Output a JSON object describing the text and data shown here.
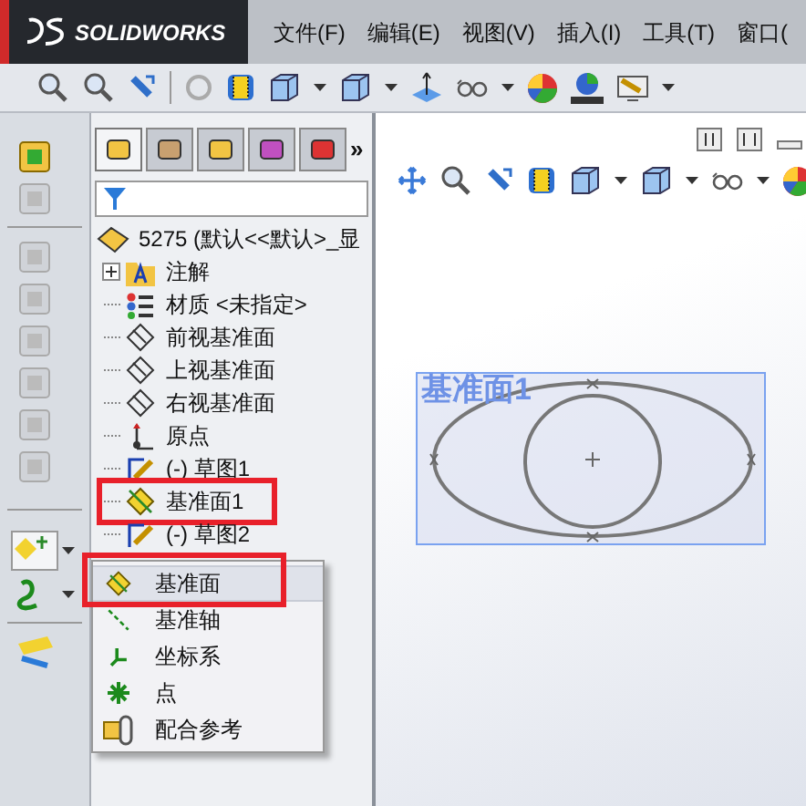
{
  "title_bar": {
    "logo": "SOLIDWORKS",
    "menu": [
      "文件(F)",
      "编辑(E)",
      "视图(V)",
      "插入(I)",
      "工具(T)",
      "窗口("
    ]
  },
  "feature_manager": {
    "tabs": [
      {
        "selected": true
      },
      {
        "selected": false
      },
      {
        "selected": false
      },
      {
        "selected": false
      },
      {
        "selected": false
      }
    ],
    "more": "»",
    "tree": {
      "label": "5275  (默认<<默认>_显",
      "children": [
        {
          "kind": "annotations",
          "label": "注解",
          "expander": true,
          "highlighted": false
        },
        {
          "kind": "material",
          "label": "材质 <未指定>",
          "expander": false,
          "highlighted": false
        },
        {
          "kind": "plane",
          "label": "前视基准面",
          "expander": false,
          "highlighted": false
        },
        {
          "kind": "plane",
          "label": "上视基准面",
          "expander": false,
          "highlighted": false
        },
        {
          "kind": "plane",
          "label": "右视基准面",
          "expander": false,
          "highlighted": false
        },
        {
          "kind": "origin",
          "label": "原点",
          "expander": false,
          "highlighted": false
        },
        {
          "kind": "sketch",
          "label": "(-) 草图1",
          "expander": false,
          "highlighted": false
        },
        {
          "kind": "refplane",
          "label": "基准面1",
          "expander": false,
          "highlighted": true
        },
        {
          "kind": "sketch",
          "label": "(-) 草图2",
          "expander": false,
          "highlighted": false
        }
      ]
    }
  },
  "graphics": {
    "plane_label": "基准面1"
  },
  "flyout_menu": [
    {
      "kind": "plane",
      "label": "基准面",
      "selected": true,
      "highlighted": true
    },
    {
      "kind": "axis",
      "label": "基准轴",
      "selected": false,
      "highlighted": false
    },
    {
      "kind": "coordinate",
      "label": "坐标系",
      "selected": false,
      "highlighted": false
    },
    {
      "kind": "point",
      "label": "点",
      "selected": false,
      "highlighted": false
    },
    {
      "kind": "mate",
      "label": "配合参考",
      "selected": false,
      "highlighted": false
    }
  ]
}
